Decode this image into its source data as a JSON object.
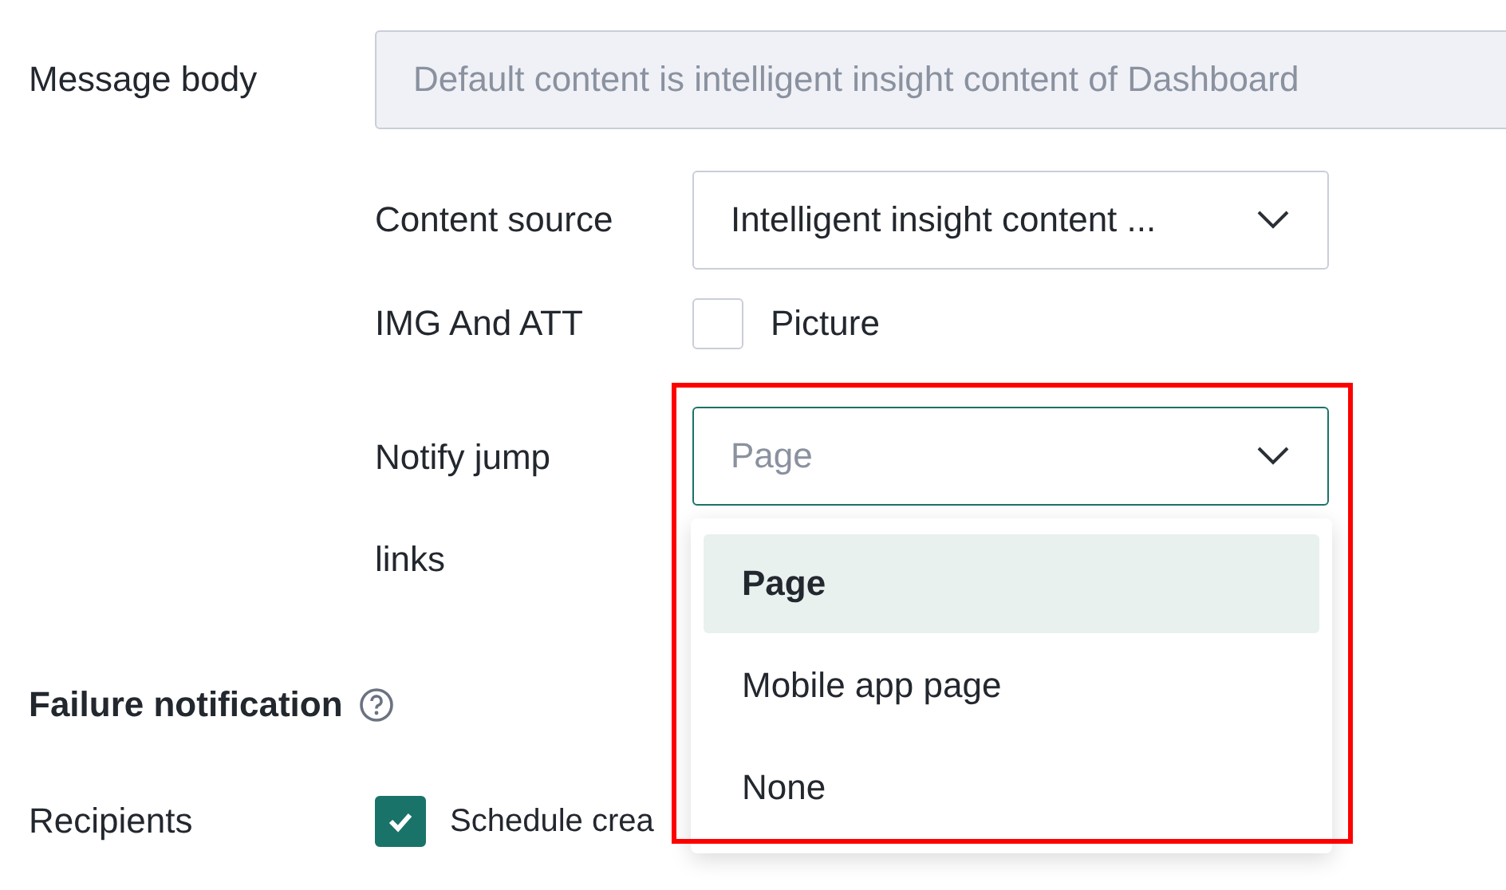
{
  "message_body": {
    "label": "Message body",
    "placeholder": "Default content is intelligent insight content of Dashboard"
  },
  "content_source": {
    "label": "Content source",
    "value": "Intelligent insight content ..."
  },
  "img_and_att": {
    "label": "IMG And ATT",
    "option": {
      "label": "Picture",
      "checked": false
    }
  },
  "notify_jump_links": {
    "label_lines": [
      "Notify jump",
      "links"
    ],
    "placeholder": "Page",
    "expanded": true,
    "options": [
      {
        "label": "Page",
        "selected": true
      },
      {
        "label": "Mobile app page",
        "selected": false
      },
      {
        "label": "None",
        "selected": false
      }
    ]
  },
  "failure_notification": {
    "title": "Failure notification",
    "recipients": {
      "label": "Recipients",
      "option": {
        "label": "Schedule crea",
        "checked": true
      }
    }
  },
  "highlight_frame": {
    "shown": true
  }
}
